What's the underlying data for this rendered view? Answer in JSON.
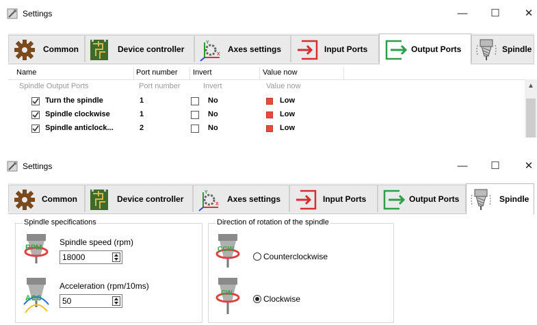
{
  "window_title": "Settings",
  "controls": {
    "minimize": "—",
    "maximize": "☐",
    "close": "✕"
  },
  "tabs": [
    {
      "label": "Common",
      "icon": "gear-icon"
    },
    {
      "label": "Device controller",
      "icon": "circuit-board-icon"
    },
    {
      "label": "Axes settings",
      "icon": "axes-icon"
    },
    {
      "label": "Input Ports",
      "icon": "input-arrow-icon"
    },
    {
      "label": "Output Ports",
      "icon": "output-arrow-icon"
    },
    {
      "label": "Spindle",
      "icon": "spindle-icon"
    }
  ],
  "window1": {
    "active_tab": "Output Ports"
  },
  "window2": {
    "active_tab": "Spindle"
  },
  "table": {
    "columns": [
      "Name",
      "Port number",
      "Invert",
      "Value now"
    ],
    "group": {
      "name": "Spindle Output Ports",
      "port": "Port number",
      "invert": "Invert",
      "value": "Value now"
    },
    "rows": [
      {
        "name": "Turn the spindle",
        "checked": true,
        "port": "1",
        "invert": "No",
        "value": "Low",
        "led_color": "#e84b3c"
      },
      {
        "name": "Spindle clockwise",
        "checked": true,
        "port": "1",
        "invert": "No",
        "value": "Low",
        "led_color": "#e84b3c"
      },
      {
        "name": "Spindle anticlock...",
        "checked": true,
        "port": "2",
        "invert": "No",
        "value": "Low",
        "led_color": "#e84b3c"
      }
    ]
  },
  "spindle_specs": {
    "title": "Spindle specifications",
    "speed_label": "Spindle speed (rpm)",
    "speed_value": "18000",
    "speed_icon_text": "RPM",
    "accel_label": "Acceleration (rpm/10ms)",
    "accel_value": "50",
    "accel_icon_text": "ACC"
  },
  "direction": {
    "title": "Direction of rotation of the spindle",
    "ccw_label": "Counterclockwise",
    "ccw_icon_text": "CCW",
    "cw_label": "Clockwise",
    "cw_icon_text": "CW",
    "selected": "Clockwise"
  }
}
